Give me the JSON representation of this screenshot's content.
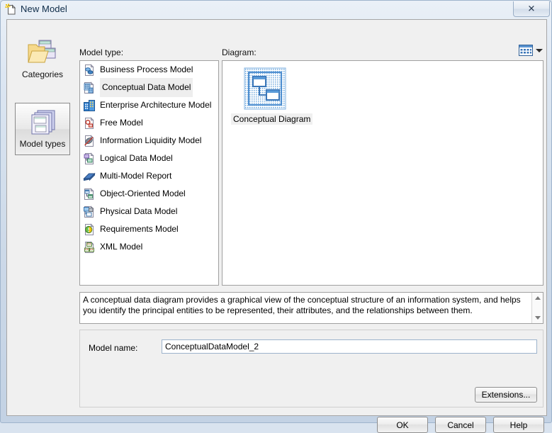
{
  "window": {
    "title": "New Model",
    "title_icon": "new-document-icon",
    "close_label": "✕"
  },
  "sidebar": {
    "items": [
      {
        "label": "Categories",
        "icon": "folder-categories-icon",
        "selected": false
      },
      {
        "label": "Model types",
        "icon": "model-types-stack-icon",
        "selected": true
      }
    ]
  },
  "labels": {
    "model_type": "Model type:",
    "diagram": "Diagram:"
  },
  "model_types": {
    "items": [
      {
        "label": "Business Process Model",
        "icon": "business-process-model-icon",
        "selected": false
      },
      {
        "label": "Conceptual Data Model",
        "icon": "conceptual-data-model-icon",
        "selected": true
      },
      {
        "label": "Enterprise Architecture Model",
        "icon": "enterprise-architecture-model-icon",
        "selected": false
      },
      {
        "label": "Free Model",
        "icon": "free-model-icon",
        "selected": false
      },
      {
        "label": "Information Liquidity Model",
        "icon": "information-liquidity-model-icon",
        "selected": false
      },
      {
        "label": "Logical Data Model",
        "icon": "logical-data-model-icon",
        "selected": false
      },
      {
        "label": "Multi-Model Report",
        "icon": "multi-model-report-icon",
        "selected": false
      },
      {
        "label": "Object-Oriented Model",
        "icon": "object-oriented-model-icon",
        "selected": false
      },
      {
        "label": "Physical Data Model",
        "icon": "physical-data-model-icon",
        "selected": false
      },
      {
        "label": "Requirements Model",
        "icon": "requirements-model-icon",
        "selected": false
      },
      {
        "label": "XML Model",
        "icon": "xml-model-icon",
        "selected": false
      }
    ]
  },
  "diagram": {
    "view_button_icon": "details-view-icon",
    "items": [
      {
        "label": "Conceptual Diagram",
        "icon": "conceptual-diagram-icon",
        "selected": true
      }
    ]
  },
  "description": {
    "text": "A conceptual data diagram provides a graphical view of the conceptual structure of an information system, and helps you identify the principal entities to be represented, their attributes, and the relationships between them."
  },
  "model_name": {
    "label": "Model name:",
    "value": "ConceptualDataModel_2",
    "placeholder": ""
  },
  "buttons": {
    "extensions": "Extensions...",
    "ok": "OK",
    "cancel": "Cancel",
    "help": "Help"
  },
  "colors": {
    "dialog_bg": "#f0f0f0",
    "titlebar_top": "#eaf0f7",
    "titlebar_bottom": "#c3d2e4",
    "selection": "#eeeeee",
    "accent_blue": "#3a76b8",
    "field_border": "#9cb3cc"
  }
}
